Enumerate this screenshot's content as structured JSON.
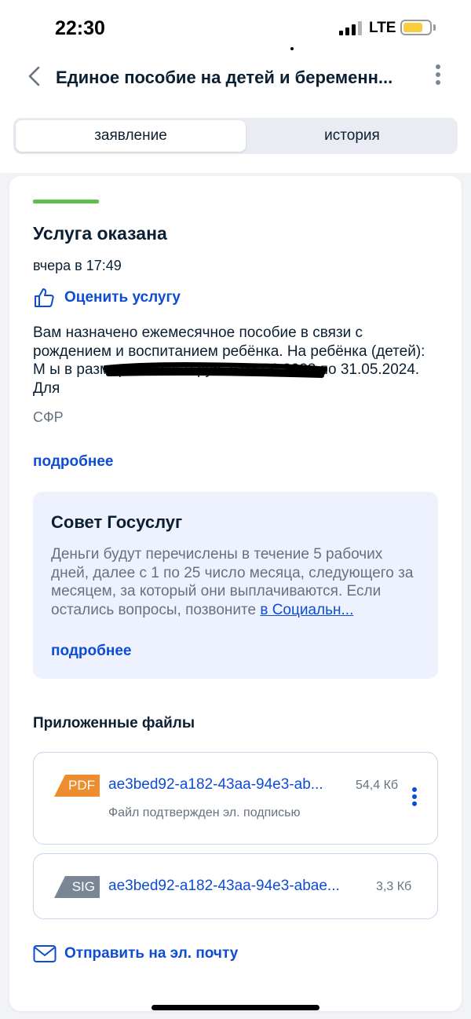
{
  "status_bar": {
    "time": "22:30",
    "network": "LTE",
    "battery_color": "#f6cd3c"
  },
  "header": {
    "title": "Единое пособие на детей и беременн..."
  },
  "tabs": [
    {
      "label": "заявление",
      "active": true
    },
    {
      "label": "история",
      "active": false
    }
  ],
  "status": {
    "title": "Услуга оказана",
    "time": "вчера в 17:49",
    "rate_label": "Оценить услугу",
    "description": "Вам назначено ежемесячное пособие в связи с рождением и воспитанием ребёнка. На ребёнка (детей): М                               ы в размере 13066.0 руб. с 01.06.2023 по 31.05.2024. Для",
    "organization": "СФР",
    "more_label": "подробнее",
    "status_color": "#5dc04c"
  },
  "tip": {
    "title": "Совет Госуслуг",
    "text": "Деньги будут перечислены в течение 5 рабочих дней, далее с 1 по 25 число месяца, следующего за месяцем, за который они выплачиваются. Если остались вопросы, позвоните ",
    "link_text": "в Социальн...",
    "more_label": "подробнее"
  },
  "files": {
    "title": "Приложенные файлы",
    "items": [
      {
        "type": "PDF",
        "name": "ae3bed92-a182-43aa-94e3-ab...",
        "size": "54,4 Кб",
        "note": "Файл подтвержден эл. подписью",
        "badge_color": "#ee8d2e"
      },
      {
        "type": "SIG",
        "name": "ae3bed92-a182-43aa-94e3-abae...",
        "size": "3,3 Кб",
        "badge_color": "#7a8595"
      }
    ]
  },
  "email_label": "Отправить на эл. почту",
  "accent_color": "#0d4cd3"
}
